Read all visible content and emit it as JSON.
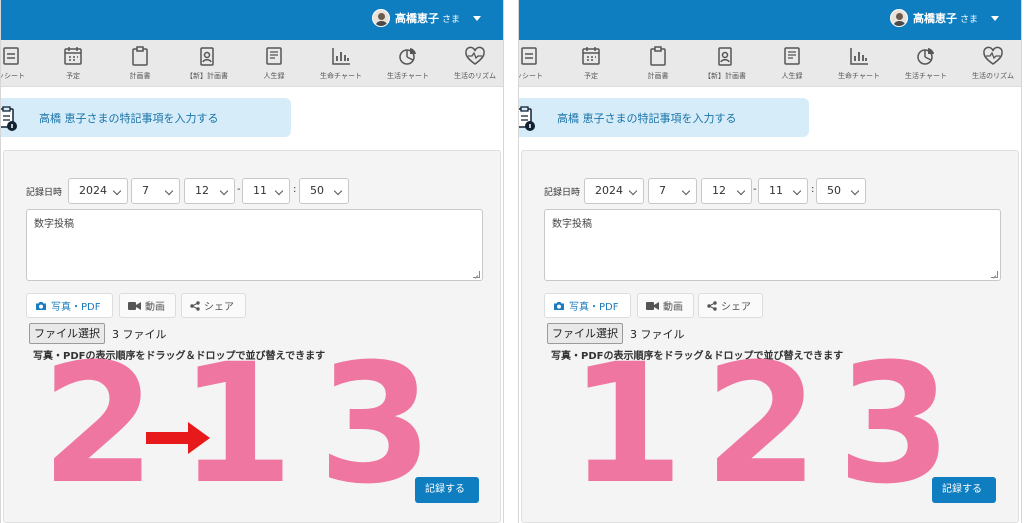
{
  "header": {
    "user_name": "高橋恵子",
    "user_suffix": "さま"
  },
  "nav": {
    "items": [
      {
        "label": "ッシート",
        "icon": "checklist-icon"
      },
      {
        "label": "予定",
        "icon": "calendar-icon"
      },
      {
        "label": "計画書",
        "icon": "clipboard-icon"
      },
      {
        "label": "【新】計画書",
        "icon": "badge-icon"
      },
      {
        "label": "人生録",
        "icon": "book-icon"
      },
      {
        "label": "生命チャート",
        "icon": "bar-chart-icon"
      },
      {
        "label": "生活チャート",
        "icon": "pie-chart-icon"
      },
      {
        "label": "生活のリズム",
        "icon": "heart-rate-icon"
      }
    ]
  },
  "banner": {
    "text": "高橋 恵子さまの特記事項を入力する"
  },
  "form": {
    "datetime_label": "記録日時",
    "year": "2024",
    "month": "7",
    "day": "12",
    "hour": "11",
    "minute": "50",
    "date_time_separator": "-",
    "time_separator": ":",
    "note_text": "数字投稿",
    "media_photo_label": "写真・PDF",
    "media_video_label": "動画",
    "media_share_label": "シェア",
    "file_button_label": "ファイル選択",
    "file_count_text": "3 ファイル",
    "reorder_hint": "写真・PDFの表示順序をドラッグ＆ドロップで並び替えできます",
    "submit_label": "記録する"
  },
  "previews": {
    "left": [
      "2",
      "1",
      "3"
    ],
    "right": [
      "1",
      "2",
      "3"
    ]
  },
  "colors": {
    "header_blue": "#0f7ec1",
    "banner_bg": "#d6ecf9",
    "preview_pink": "#ee76a0",
    "arrow_red": "#e8191b"
  }
}
